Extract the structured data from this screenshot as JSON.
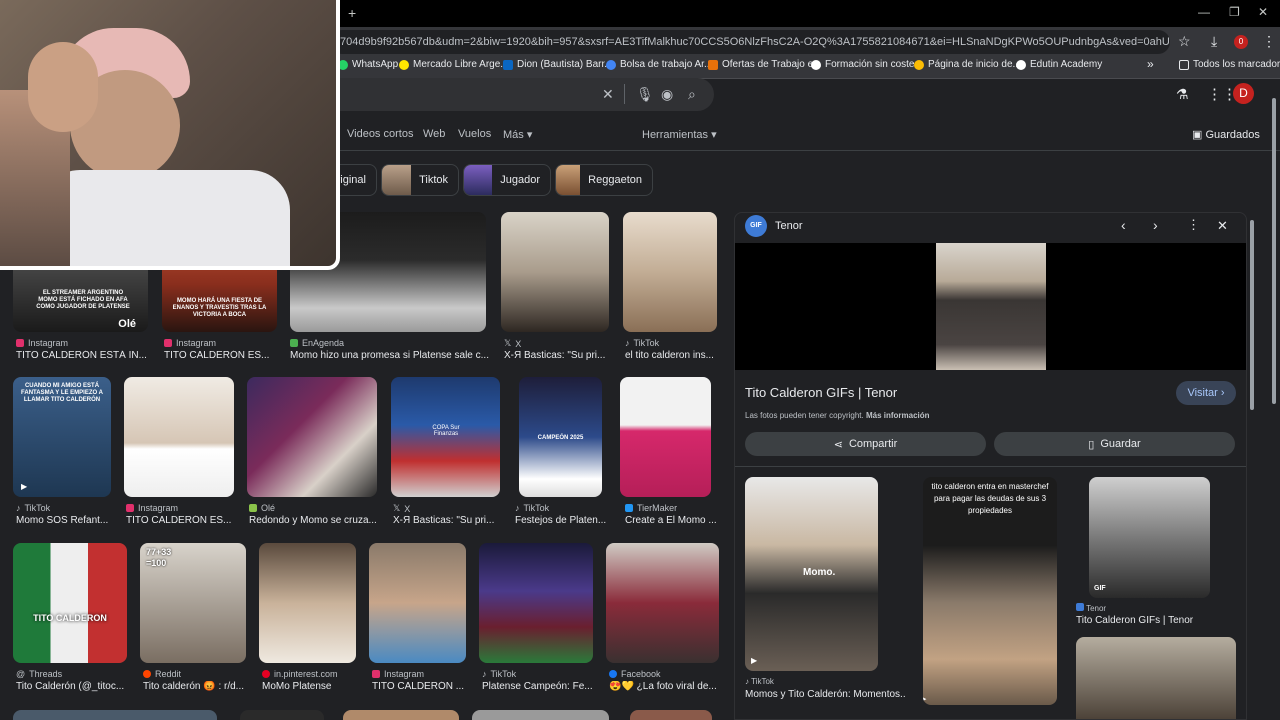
{
  "browser": {
    "new_tab_label": "+",
    "address_url": "704d9b9f92b567db&udm=2&biw=1920&bih=957&sxsrf=AE3TifMalkhuc70CCS5O6NlzFhsC2A-O2Q%3A1755821084671&ei=HLSnaNDgKPWo5OUPudnbgAs&ved=0ahUKEwjQ3qmgj52PAxV1FLkGHb...",
    "window_controls": {
      "minimize": "—",
      "restore": "❐",
      "close": "✕"
    },
    "bookmarks": [
      {
        "label": "WhatsApp",
        "color": "#25d366"
      },
      {
        "label": "Mercado Libre Arge...",
        "color": "#ffe600"
      },
      {
        "label": "Dion (Bautista) Barr...",
        "color": "#0a66c2"
      },
      {
        "label": "Bolsa de trabajo Ar...",
        "color": "#4285f4"
      },
      {
        "label": "Ofertas de Trabajo e...",
        "color": "#e8710a"
      },
      {
        "label": "Formación sin coste...",
        "color": "#ffffff"
      },
      {
        "label": "Página de inicio de...",
        "color": "#fbbc04"
      },
      {
        "label": "Edutin Academy",
        "color": "#ffffff"
      }
    ],
    "bookmarks_overflow": "»",
    "all_bookmarks": "Todos los marcadores",
    "profile_initial": "D",
    "download_badge": "0"
  },
  "search": {
    "nav": [
      "Videos cortos",
      "Web",
      "Vuelos",
      "Más ▾"
    ],
    "tools": "Herramientas ▾",
    "saved": "Guardados",
    "chips": [
      "riginal",
      "Tiktok",
      "Jugador",
      "Reggaeton"
    ],
    "results_row1": [
      {
        "source": "Instagram",
        "caption": "TITO CALDERÓN ESTÁ IN...",
        "fav": "#e1306c",
        "overlay": "EL STREAMER ARGENTINO MOMO ESTÁ FICHADO EN AFA COMO JUGADOR DE PLATENSE",
        "badge": "Olé"
      },
      {
        "source": "Instagram",
        "caption": "TITO CALDERÓN ES...",
        "fav": "#e1306c",
        "overlay": "MOMO HARÁ UNA FIESTA DE ENANOS Y TRAVESTIS TRAS LA VICTORIA A BOCA"
      },
      {
        "source": "EnAgenda",
        "caption": "Momo hizo una promesa si Platense sale c...",
        "fav": "#4caf50"
      },
      {
        "source": "X",
        "caption": "X-Я Basticas: \"Su pri...",
        "fav": "#ffffff"
      },
      {
        "source": "TikTok",
        "caption": "el tito calderon ins...",
        "fav": "#ffffff"
      }
    ],
    "results_row2": [
      {
        "source": "TikTok",
        "caption": "Momo SOS Refant...",
        "fav": "#ffffff",
        "overlay": "CUANDO MI AMIGO ESTÁ FANTASMA Y LE EMPIEZO A LLAMAR TITO CALDERÓN"
      },
      {
        "source": "Instagram",
        "caption": "TITO CALDERÓN ES...",
        "fav": "#e1306c"
      },
      {
        "source": "Olé",
        "caption": "Redondo y Momo se cruza...",
        "fav": "#8bc34a"
      },
      {
        "source": "X",
        "caption": "X-Я Basticas: \"Su pri...",
        "fav": "#ffffff",
        "overlay": "COPA Sur Finanzas"
      },
      {
        "source": "TikTok",
        "caption": "Festejos de Platen...",
        "fav": "#ffffff",
        "overlay": "CAMPEÓN 2025"
      },
      {
        "source": "TierMaker",
        "caption": "Create a El Momo ...",
        "fav": "#2196f3"
      }
    ],
    "results_row3": [
      {
        "source": "Threads",
        "caption": "Tito Calderón (@_titoc...",
        "fav": "#ffffff",
        "overlay": "TITO CALDERON"
      },
      {
        "source": "Reddit",
        "caption": "Tito calderón 😡 : r/d...",
        "fav": "#ff4500",
        "overlay": "77+33 =100"
      },
      {
        "source": "in.pinterest.com",
        "caption": "MoMo Platense",
        "fav": "#e60023"
      },
      {
        "source": "Instagram",
        "caption": "TITO CALDERÓN ...",
        "fav": "#e1306c"
      },
      {
        "source": "TikTok",
        "caption": "Platense Campeón: Fe...",
        "fav": "#ffffff"
      },
      {
        "source": "Facebook",
        "caption": "😍💛 ¿La foto viral de...",
        "fav": "#1877f2"
      }
    ]
  },
  "panel": {
    "source_name": "Tenor",
    "source_logo": "GIF",
    "title": "Tito Calderon GIFs | Tenor",
    "visit_label": "Visitar",
    "copyright_text": "Las fotos pueden tener copyright.",
    "more_info": "Más información",
    "share_label": "Compartir",
    "save_label": "Guardar",
    "related": [
      {
        "source": "TikTok",
        "caption": "Momos y Tito Calderón: Momentos...",
        "overlay": "Momo."
      },
      {
        "source": "",
        "caption": "",
        "overlay": "tito calderon entra en masterchef para pagar las deudas de sus 3 propiedades"
      },
      {
        "source": "Tenor",
        "caption": "Tito Calderon GIFs | Tenor",
        "overlay": "GIF"
      }
    ]
  },
  "colors": {
    "accent_blue": "#8ab4f8",
    "visit_button": "#394457",
    "profile": "#c5221f"
  }
}
